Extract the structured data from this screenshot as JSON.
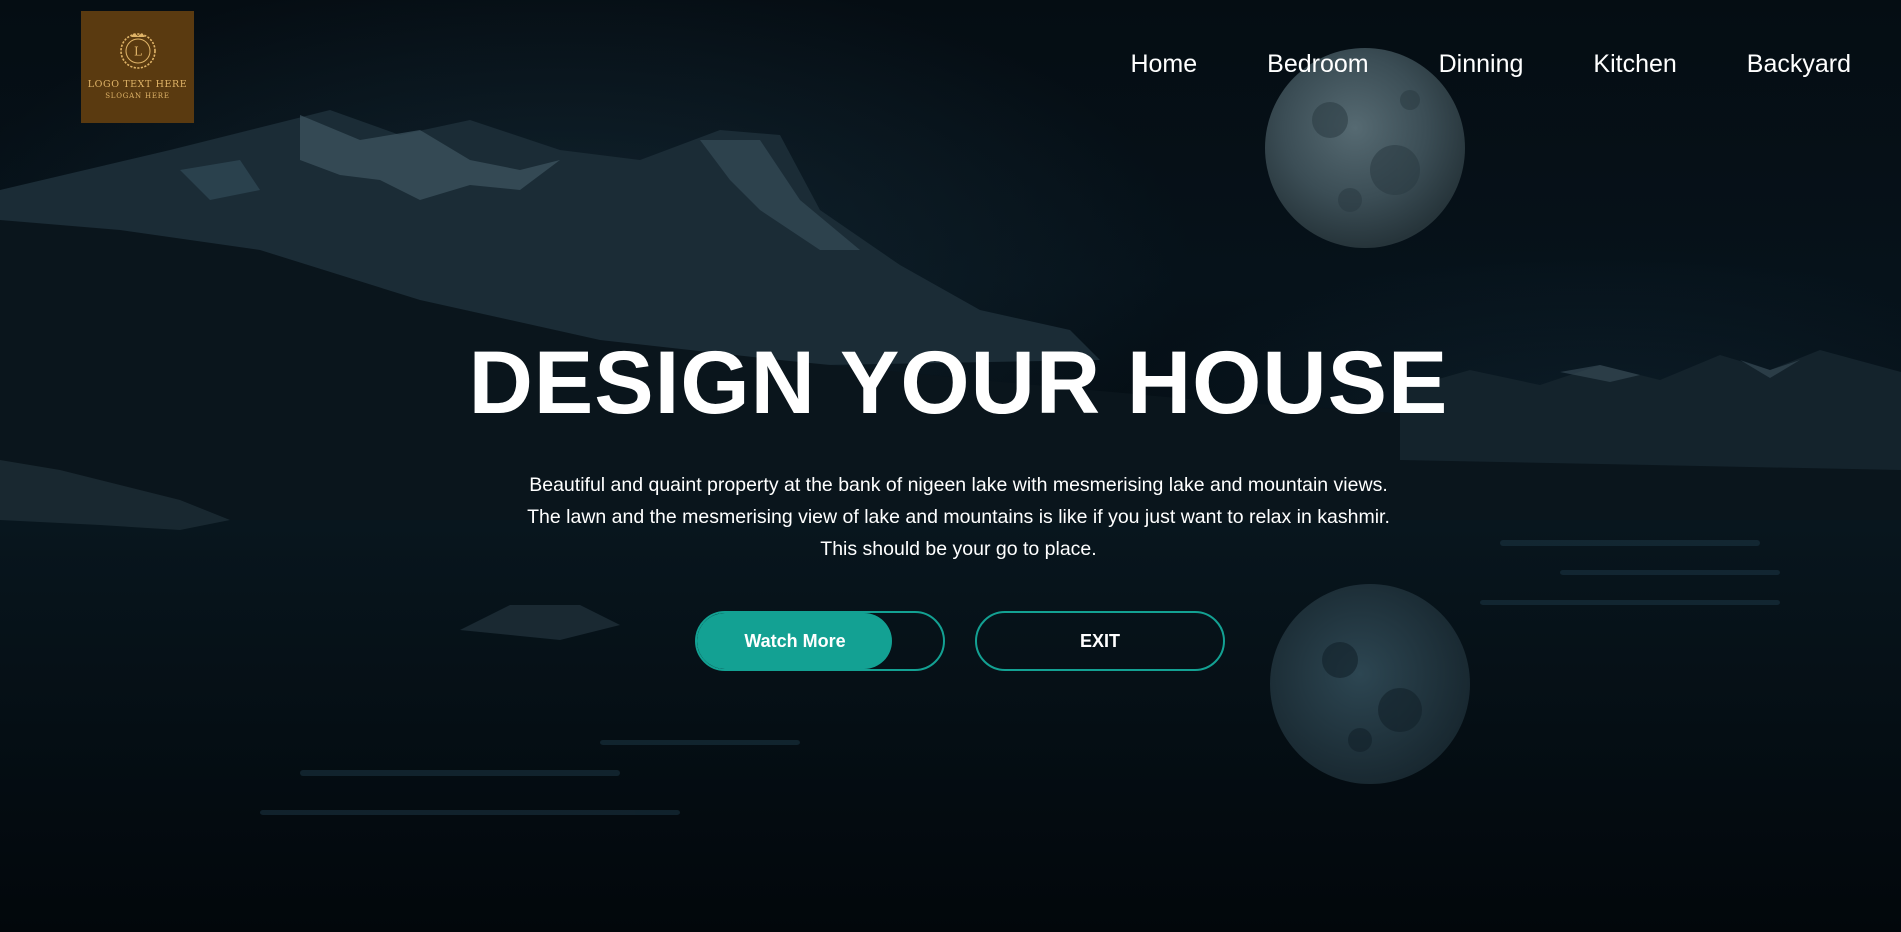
{
  "logo": {
    "text": "LOGO TEXT HERE",
    "slogan": "SLOGAN HERE",
    "emblem_letter": "L",
    "background": "#5a3a10",
    "accent": "#e0b468"
  },
  "nav": {
    "items": [
      {
        "label": "Home"
      },
      {
        "label": "Bedroom"
      },
      {
        "label": "Dinning"
      },
      {
        "label": "Kitchen"
      },
      {
        "label": "Backyard"
      }
    ]
  },
  "hero": {
    "title": "DESIGN YOUR HOUSE",
    "description": [
      "Beautiful and quaint property at the bank of nigeen lake with mesmerising lake and mountain views.",
      "The lawn and the mesmerising view of lake and mountains is like if you just want to relax in kashmir.",
      "This should be your go to place."
    ]
  },
  "buttons": {
    "watch_more": "Watch More",
    "exit": "EXIT",
    "accent": "#13a193"
  },
  "colors": {
    "background": "#02090e",
    "text": "#ffffff"
  }
}
